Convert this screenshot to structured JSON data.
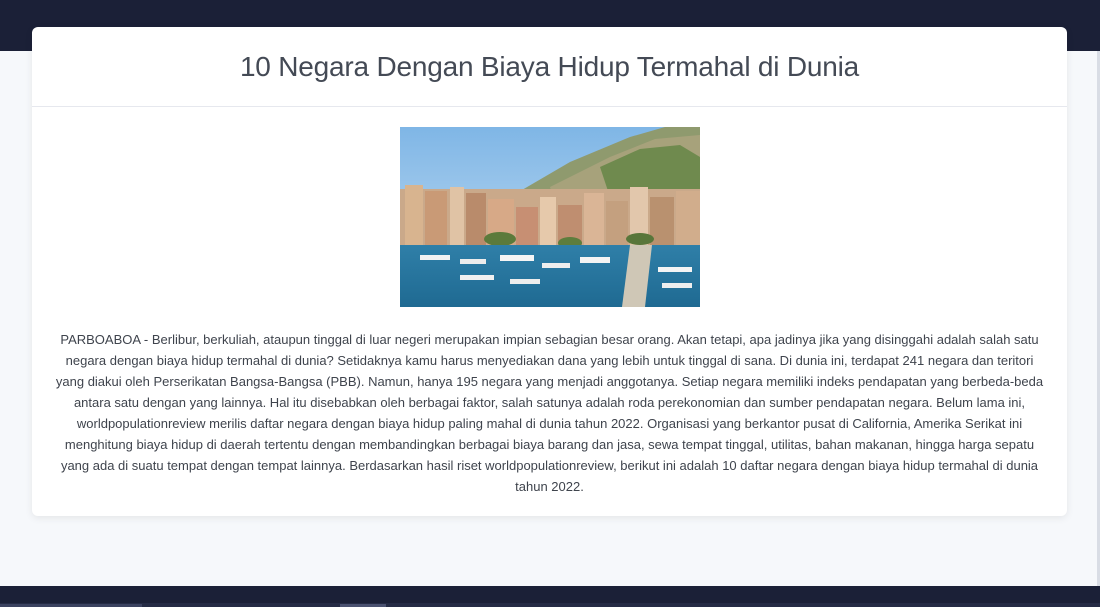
{
  "article": {
    "title": "10 Negara Dengan Biaya Hidup Termahal di Dunia",
    "body": "PARBOABOA - Berlibur, berkuliah, ataupun tinggal di luar negeri merupakan impian sebagian besar orang. Akan tetapi, apa jadinya jika yang disinggahi adalah salah satu negara dengan biaya hidup termahal di dunia? Setidaknya kamu harus menyediakan dana yang lebih untuk tinggal di sana. Di dunia ini, terdapat 241 negara dan teritori yang diakui oleh Perserikatan Bangsa-Bangsa (PBB). Namun, hanya 195 negara yang menjadi anggotanya. Setiap negara memiliki indeks pendapatan yang berbeda-beda antara satu dengan yang lainnya. Hal itu disebabkan oleh berbagai faktor, salah satunya adalah roda perekonomian dan sumber pendapatan negara. Belum lama ini, worldpopulationreview merilis daftar negara dengan biaya hidup paling mahal di dunia tahun 2022. Organisasi yang berkantor pusat di California, Amerika Serikat ini menghitung biaya hidup di daerah tertentu dengan membandingkan berbagai biaya barang dan jasa, sewa tempat tinggal, utilitas, bahan makanan, hingga harga sepatu yang ada di suatu tempat dengan tempat lainnya. Berdasarkan hasil riset worldpopulationreview, berikut ini adalah 10 daftar negara dengan biaya hidup termahal di dunia tahun 2022."
  },
  "colors": {
    "nav_bar": "#1b2037",
    "page_background": "#f6f8fb",
    "card_background": "#ffffff",
    "title_text": "#444a55",
    "body_text": "#3f444d"
  }
}
